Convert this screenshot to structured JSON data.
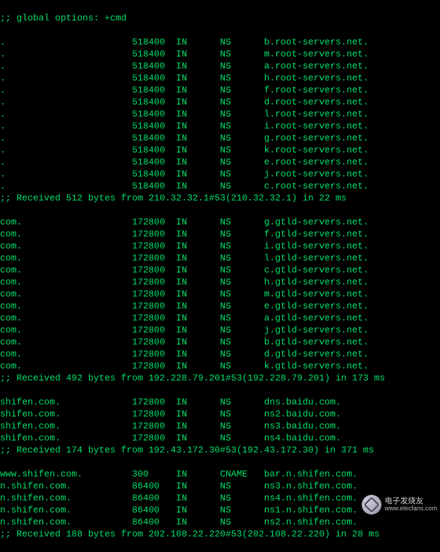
{
  "header": ";; global options: +cmd",
  "blocks": [
    {
      "records": [
        {
          "name": ".",
          "ttl": "518400",
          "class": "IN",
          "type": "NS",
          "value": "b.root-servers.net."
        },
        {
          "name": ".",
          "ttl": "518400",
          "class": "IN",
          "type": "NS",
          "value": "m.root-servers.net."
        },
        {
          "name": ".",
          "ttl": "518400",
          "class": "IN",
          "type": "NS",
          "value": "a.root-servers.net."
        },
        {
          "name": ".",
          "ttl": "518400",
          "class": "IN",
          "type": "NS",
          "value": "h.root-servers.net."
        },
        {
          "name": ".",
          "ttl": "518400",
          "class": "IN",
          "type": "NS",
          "value": "f.root-servers.net."
        },
        {
          "name": ".",
          "ttl": "518400",
          "class": "IN",
          "type": "NS",
          "value": "d.root-servers.net."
        },
        {
          "name": ".",
          "ttl": "518400",
          "class": "IN",
          "type": "NS",
          "value": "l.root-servers.net."
        },
        {
          "name": ".",
          "ttl": "518400",
          "class": "IN",
          "type": "NS",
          "value": "i.root-servers.net."
        },
        {
          "name": ".",
          "ttl": "518400",
          "class": "IN",
          "type": "NS",
          "value": "g.root-servers.net."
        },
        {
          "name": ".",
          "ttl": "518400",
          "class": "IN",
          "type": "NS",
          "value": "k.root-servers.net."
        },
        {
          "name": ".",
          "ttl": "518400",
          "class": "IN",
          "type": "NS",
          "value": "e.root-servers.net."
        },
        {
          "name": ".",
          "ttl": "518400",
          "class": "IN",
          "type": "NS",
          "value": "j.root-servers.net."
        },
        {
          "name": ".",
          "ttl": "518400",
          "class": "IN",
          "type": "NS",
          "value": "c.root-servers.net."
        }
      ],
      "status": ";; Received 512 bytes from 210.32.32.1#53(210.32.32.1) in 22 ms"
    },
    {
      "records": [
        {
          "name": "com.",
          "ttl": "172800",
          "class": "IN",
          "type": "NS",
          "value": "g.gtld-servers.net."
        },
        {
          "name": "com.",
          "ttl": "172800",
          "class": "IN",
          "type": "NS",
          "value": "f.gtld-servers.net."
        },
        {
          "name": "com.",
          "ttl": "172800",
          "class": "IN",
          "type": "NS",
          "value": "i.gtld-servers.net."
        },
        {
          "name": "com.",
          "ttl": "172800",
          "class": "IN",
          "type": "NS",
          "value": "l.gtld-servers.net."
        },
        {
          "name": "com.",
          "ttl": "172800",
          "class": "IN",
          "type": "NS",
          "value": "c.gtld-servers.net."
        },
        {
          "name": "com.",
          "ttl": "172800",
          "class": "IN",
          "type": "NS",
          "value": "h.gtld-servers.net."
        },
        {
          "name": "com.",
          "ttl": "172800",
          "class": "IN",
          "type": "NS",
          "value": "m.gtld-servers.net."
        },
        {
          "name": "com.",
          "ttl": "172800",
          "class": "IN",
          "type": "NS",
          "value": "e.gtld-servers.net."
        },
        {
          "name": "com.",
          "ttl": "172800",
          "class": "IN",
          "type": "NS",
          "value": "a.gtld-servers.net."
        },
        {
          "name": "com.",
          "ttl": "172800",
          "class": "IN",
          "type": "NS",
          "value": "j.gtld-servers.net."
        },
        {
          "name": "com.",
          "ttl": "172800",
          "class": "IN",
          "type": "NS",
          "value": "b.gtld-servers.net."
        },
        {
          "name": "com.",
          "ttl": "172800",
          "class": "IN",
          "type": "NS",
          "value": "d.gtld-servers.net."
        },
        {
          "name": "com.",
          "ttl": "172800",
          "class": "IN",
          "type": "NS",
          "value": "k.gtld-servers.net."
        }
      ],
      "status": ";; Received 492 bytes from 192.228.79.201#53(192.228.79.201) in 173 ms"
    },
    {
      "records": [
        {
          "name": "shifen.com.",
          "ttl": "172800",
          "class": "IN",
          "type": "NS",
          "value": "dns.baidu.com."
        },
        {
          "name": "shifen.com.",
          "ttl": "172800",
          "class": "IN",
          "type": "NS",
          "value": "ns2.baidu.com."
        },
        {
          "name": "shifen.com.",
          "ttl": "172800",
          "class": "IN",
          "type": "NS",
          "value": "ns3.baidu.com."
        },
        {
          "name": "shifen.com.",
          "ttl": "172800",
          "class": "IN",
          "type": "NS",
          "value": "ns4.baidu.com."
        }
      ],
      "status": ";; Received 174 bytes from 192.43.172.30#53(192.43.172.30) in 371 ms"
    },
    {
      "records": [
        {
          "name": "www.shifen.com.",
          "ttl": "300",
          "class": "IN",
          "type": "CNAME",
          "value": "bar.n.shifen.com."
        },
        {
          "name": "n.shifen.com.",
          "ttl": "86400",
          "class": "IN",
          "type": "NS",
          "value": "ns3.n.shifen.com."
        },
        {
          "name": "n.shifen.com.",
          "ttl": "86400",
          "class": "IN",
          "type": "NS",
          "value": "ns4.n.shifen.com."
        },
        {
          "name": "n.shifen.com.",
          "ttl": "86400",
          "class": "IN",
          "type": "NS",
          "value": "ns1.n.shifen.com."
        },
        {
          "name": "n.shifen.com.",
          "ttl": "86400",
          "class": "IN",
          "type": "NS",
          "value": "ns2.n.shifen.com."
        }
      ],
      "status": ";; Received 188 bytes from 202.108.22.220#53(202.108.22.220) in 28 ms"
    }
  ],
  "watermark": {
    "cn": "电子发烧友",
    "url": "www.elecfans.com"
  },
  "column_widths": {
    "name": 24,
    "ttl": 8,
    "class": 8,
    "type": 8
  }
}
